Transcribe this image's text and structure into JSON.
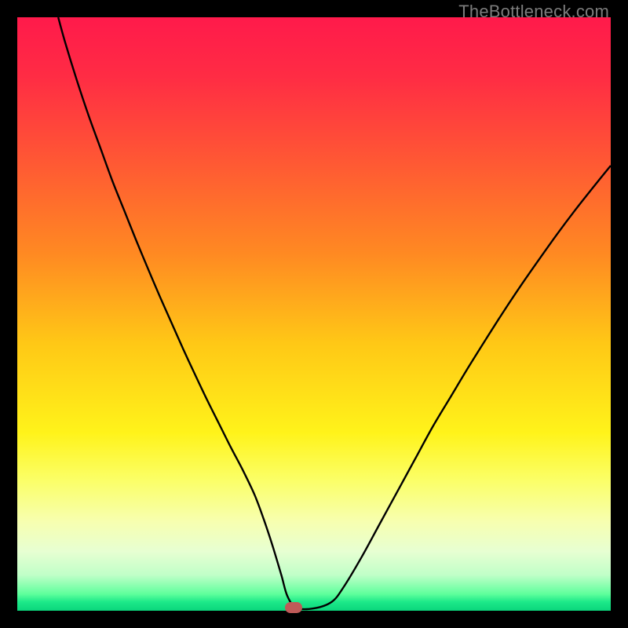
{
  "watermark": "TheBottleneck.com",
  "chart_data": {
    "type": "line",
    "title": "",
    "xlabel": "",
    "ylabel": "",
    "xlim": [
      0,
      100
    ],
    "ylim": [
      0,
      100
    ],
    "grid": false,
    "background_gradient": [
      {
        "stop": 0.0,
        "color": "#ff1a4b"
      },
      {
        "stop": 0.1,
        "color": "#ff2c44"
      },
      {
        "stop": 0.25,
        "color": "#ff5a33"
      },
      {
        "stop": 0.4,
        "color": "#ff8a22"
      },
      {
        "stop": 0.55,
        "color": "#ffc816"
      },
      {
        "stop": 0.7,
        "color": "#fff31a"
      },
      {
        "stop": 0.78,
        "color": "#fbff67"
      },
      {
        "stop": 0.85,
        "color": "#f7ffb0"
      },
      {
        "stop": 0.9,
        "color": "#e7ffd2"
      },
      {
        "stop": 0.94,
        "color": "#c0ffc8"
      },
      {
        "stop": 0.972,
        "color": "#5eff9c"
      },
      {
        "stop": 0.985,
        "color": "#1de989"
      },
      {
        "stop": 1.0,
        "color": "#0bd67c"
      }
    ],
    "series": [
      {
        "name": "bottleneck-curve",
        "stroke": "#000000",
        "stroke_width": 2.4,
        "x": [
          6.9,
          8,
          10,
          12,
          14,
          16,
          18,
          20,
          22,
          24,
          26,
          28,
          30,
          32,
          34,
          36,
          38,
          40,
          41.5,
          43,
          44.5,
          45.5,
          47,
          50,
          53,
          55,
          58,
          61,
          64,
          67,
          70,
          73,
          76,
          79,
          82,
          85,
          88,
          91,
          94,
          97,
          100
        ],
        "y": [
          100,
          96,
          89.5,
          83.5,
          78,
          72.5,
          67.5,
          62.5,
          57.7,
          53,
          48.5,
          44,
          39.7,
          35.5,
          31.5,
          27.5,
          23.7,
          19.5,
          15.5,
          11,
          6,
          2.5,
          0.5,
          0.4,
          1.5,
          4,
          9,
          14.5,
          20,
          25.5,
          31,
          36,
          41,
          45.8,
          50.5,
          55,
          59.3,
          63.5,
          67.5,
          71.3,
          75
        ]
      }
    ],
    "marker": {
      "x": 46.5,
      "y": 0.5,
      "color": "#bf5a58"
    },
    "annotations": []
  }
}
